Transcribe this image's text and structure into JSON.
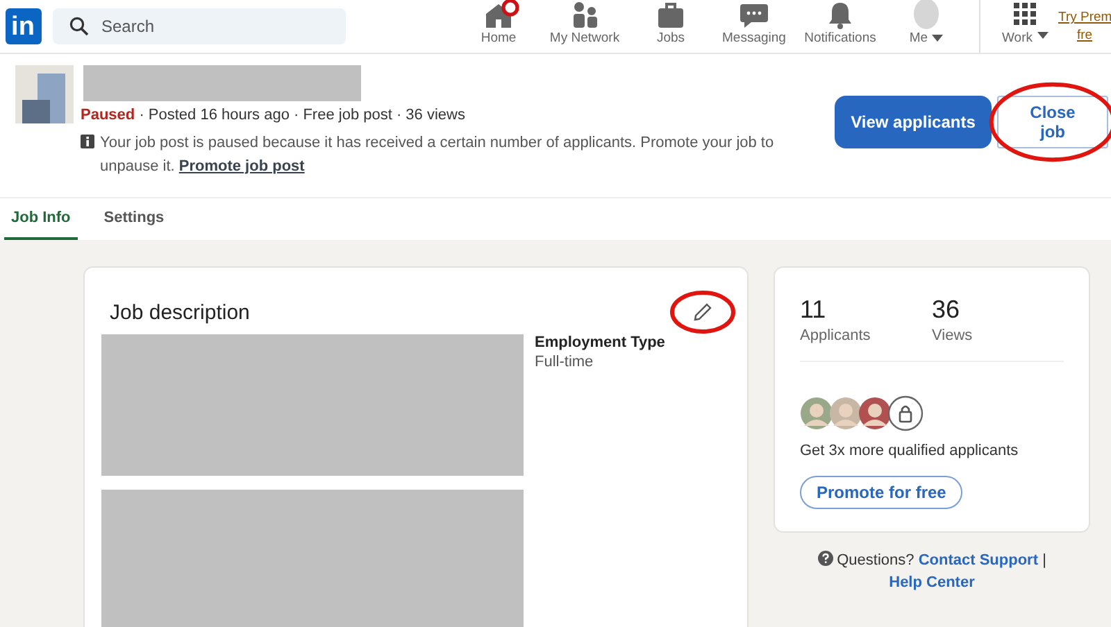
{
  "navbar": {
    "logo": "in",
    "search": {
      "placeholder": "Search"
    },
    "items": [
      {
        "label": "Home",
        "notification": true,
        "dropdown": false
      },
      {
        "label": "My Network",
        "notification": false,
        "dropdown": false
      },
      {
        "label": "Jobs",
        "notification": false,
        "dropdown": false
      },
      {
        "label": "Messaging",
        "notification": false,
        "dropdown": false
      },
      {
        "label": "Notifications",
        "notification": false,
        "dropdown": false
      },
      {
        "label": "Me",
        "notification": false,
        "dropdown": true
      }
    ],
    "work": {
      "label": "Work",
      "dropdown": true
    },
    "premium_link": [
      "Try Prem",
      "fre"
    ]
  },
  "job_header": {
    "status": "Paused",
    "meta": " · Posted 16 hours ago · Free job post · 36 views",
    "notice": "Your job post is paused because it has received a certain number of applicants. Promote your job to unpause it.",
    "notice_link": "Promote job post",
    "buttons": [
      {
        "label": "View applicants",
        "kind": "primary",
        "circled": false
      },
      {
        "label": "Close job",
        "kind": "secondary",
        "circled": true
      }
    ]
  },
  "tabs": [
    {
      "label": "Job Info",
      "selected": true
    },
    {
      "label": "Settings",
      "selected": false
    }
  ],
  "job_description": {
    "title": "Job description",
    "edit_circled": true,
    "details": [
      {
        "label": "Employment Type",
        "value": "Full-time"
      }
    ]
  },
  "stats": [
    {
      "value": "11",
      "label": "Applicants"
    },
    {
      "value": "36",
      "label": "Views"
    }
  ],
  "promote": {
    "text": "Get 3x more qualified applicants",
    "button": "Promote for free"
  },
  "help": {
    "text": "Questions?",
    "links": [
      "Contact Support",
      "Help Center"
    ],
    "separator": "|"
  }
}
